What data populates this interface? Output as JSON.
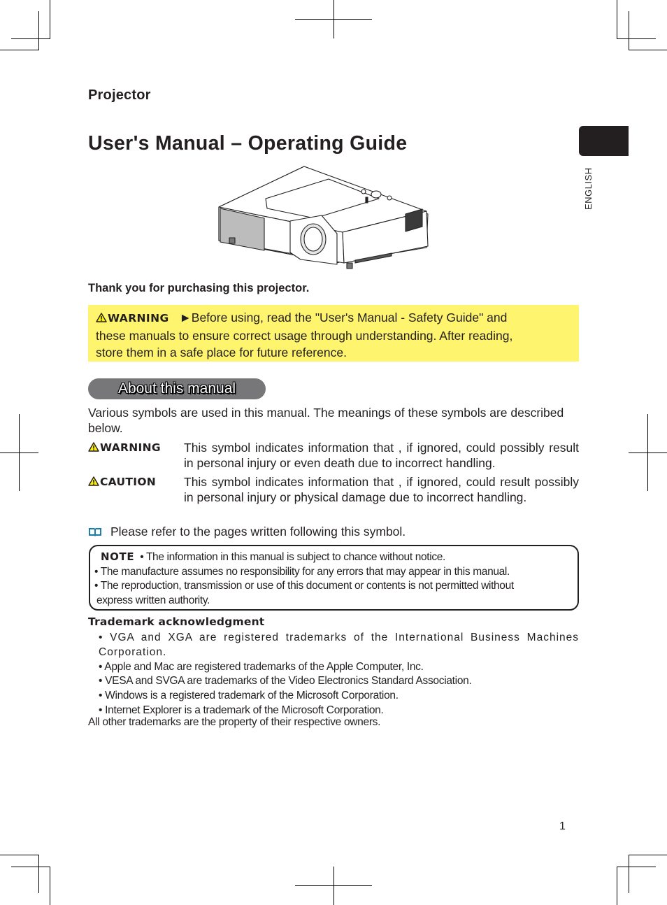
{
  "header": {
    "product": "Projector",
    "title": "User's Manual – Operating Guide",
    "language_tab": "ENGLISH"
  },
  "illustration": {
    "icon": "projector-illustration"
  },
  "intro": {
    "thanks": "Thank you for purchasing this projector."
  },
  "warning_box": {
    "label": "WARNING",
    "arrow": "►",
    "text_line1": "Before using, read the \"User's Manual - Safety Guide\" and",
    "text_line2": "these manuals to ensure correct usage through understanding. After reading,",
    "text_line3": "store them in a safe place for future reference.",
    "background_color": "#fff46e"
  },
  "about_section": {
    "heading": "About this manual",
    "pill_color": "#77777a",
    "intro": "Various symbols are used in this manual. The meanings of these symbols are described below.",
    "symbols": [
      {
        "term": "WARNING",
        "icon": "warning-triangle-icon",
        "description": "This symbol indicates information that , if ignored, could possibly result in personal injury or even death due to incorrect handling."
      },
      {
        "term": "CAUTION",
        "icon": "warning-triangle-icon",
        "description": "This symbol indicates information that , if ignored, could result possibly in personal injury or physical damage due to incorrect handling."
      }
    ],
    "reference": {
      "icon": "book-icon",
      "icon_color": "#1a7fa8",
      "text": "Please refer to the pages written following this symbol."
    }
  },
  "note": {
    "label": "NOTE",
    "lines": [
      "• The information in this manual is subject to chance without notice.",
      "• The manufacture assumes no responsibility for any errors that may appear in this manual.",
      "• The reproduction, transmission or use of this document or contents is not permitted without",
      "express written authority."
    ]
  },
  "trademarks": {
    "heading": "Trademark acknowledgment",
    "items": [
      "• VGA and XGA are registered trademarks of the International Business Machines Corporation.",
      "• Apple and Mac are registered trademarks of the Apple Computer, Inc.",
      "• VESA and SVGA are trademarks of the Video Electronics Standard Association.",
      "• Windows is a registered trademark of the Microsoft Corporation.",
      "• Internet Explorer is a trademark of the Microsoft Corporation."
    ],
    "footer": "All other trademarks are the property of their respective owners."
  },
  "footer": {
    "page_number": "1"
  }
}
